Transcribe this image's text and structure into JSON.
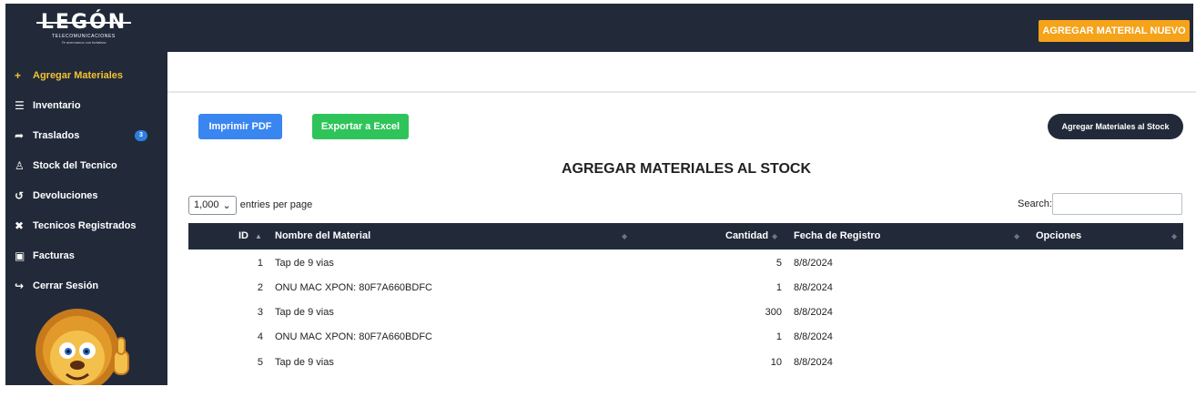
{
  "header": {
    "logo_text": "LEGÓN",
    "logo_subtitle": "TELECOMUNICACIONES",
    "logo_slogan": "Te acercamos con fortaleza",
    "new_material_button": "AGREGAR MATERIAL NUEVO"
  },
  "sidebar": {
    "items": [
      {
        "icon": "plus-icon",
        "glyph": "+",
        "label": "Agregar Materiales",
        "active": true
      },
      {
        "icon": "list-icon",
        "glyph": "☰",
        "label": "Inventario"
      },
      {
        "icon": "share-arrow-icon",
        "glyph": "➦",
        "label": "Traslados",
        "badge": "3"
      },
      {
        "icon": "person-icon",
        "glyph": "♙",
        "label": "Stock del Tecnico"
      },
      {
        "icon": "undo-icon",
        "glyph": "↺",
        "label": "Devoluciones"
      },
      {
        "icon": "tools-icon",
        "glyph": "✖",
        "label": "Tecnicos Registrados"
      },
      {
        "icon": "money-bill-icon",
        "glyph": "▣",
        "label": "Facturas"
      },
      {
        "icon": "sign-out-icon",
        "glyph": "↪",
        "label": "Cerrar Sesión"
      }
    ]
  },
  "toolbar": {
    "print_pdf": "Imprimir PDF",
    "export_excel": "Exportar a Excel",
    "add_to_stock": "Agregar Materiales al Stock"
  },
  "page_title": "AGREGAR MATERIALES AL STOCK",
  "table_controls": {
    "entries_value": "1,000",
    "entries_suffix": "entries per page",
    "search_label": "Search:",
    "search_value": ""
  },
  "table": {
    "columns": [
      "ID",
      "Nombre del Material",
      "Cantidad",
      "Fecha de Registro",
      "Opciones"
    ],
    "rows": [
      {
        "id": "1",
        "name": "Tap de 9 vias",
        "qty": "5",
        "date": "8/8/2024"
      },
      {
        "id": "2",
        "name": "ONU MAC XPON: 80F7A660BDFC",
        "qty": "1",
        "date": "8/8/2024"
      },
      {
        "id": "3",
        "name": "Tap de 9 vias",
        "qty": "300",
        "date": "8/8/2024"
      },
      {
        "id": "4",
        "name": "ONU MAC XPON: 80F7A660BDFC",
        "qty": "1",
        "date": "8/8/2024"
      },
      {
        "id": "5",
        "name": "Tap de 9 vias",
        "qty": "10",
        "date": "8/8/2024"
      }
    ]
  },
  "colors": {
    "navy": "#222a3a",
    "orange": "#f5a31a",
    "blue": "#3a86f0",
    "green": "#2fc45a",
    "active_nav": "#f2c230"
  }
}
